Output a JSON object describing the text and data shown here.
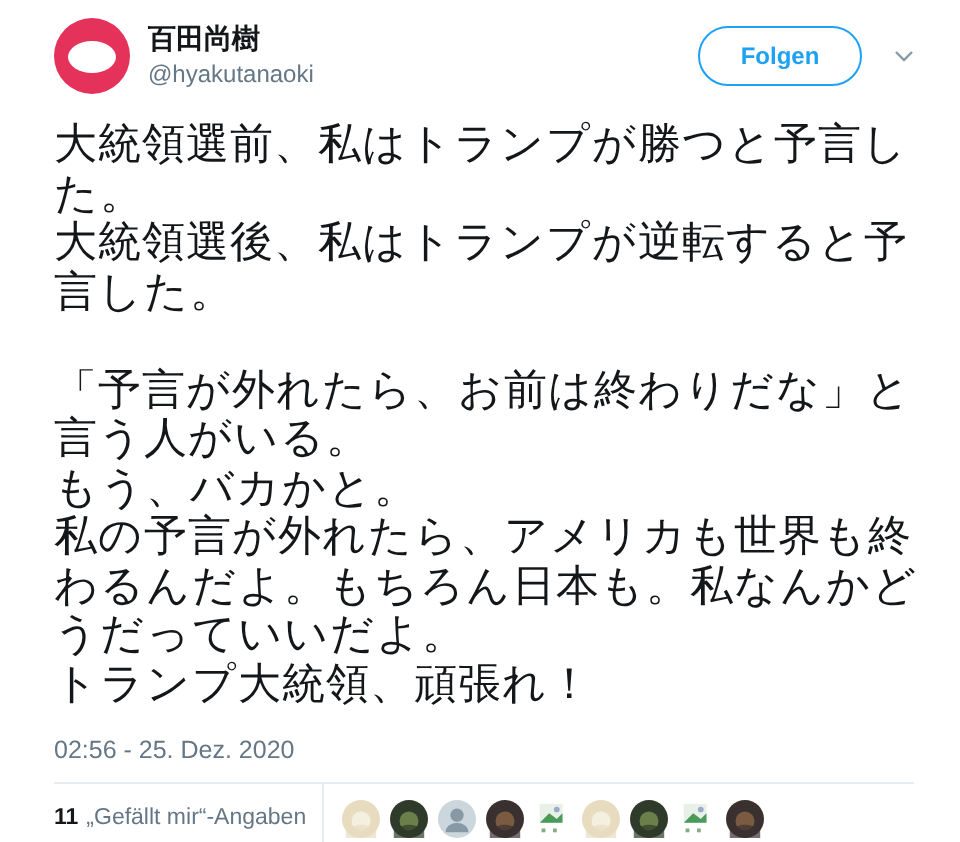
{
  "author": {
    "name": "百田尚樹",
    "handle": "@hyakutanaoki"
  },
  "follow_button": "Folgen",
  "paragraphs": [
    [
      "大統領選前、私はトランプが勝つと予言した。",
      "大統領選後、私はトランプが逆転すると予言した。"
    ],
    [
      "「予言が外れたら、お前は終わりだな」と言う人がいる。",
      "もう、バカかと。",
      "私の予言が外れたら、アメリカも世界も終わるんだよ。もちろん日本も。私なんかどうだっていいだよ。",
      "トランプ大統領、頑張れ！"
    ]
  ],
  "timestamp": "02:56 - 25. Dez. 2020",
  "likes": {
    "count": "11",
    "label": "„Gefällt mir“-Angaben",
    "avatars": [
      {
        "kind": "picture"
      },
      {
        "kind": "picture"
      },
      {
        "kind": "default"
      },
      {
        "kind": "picture"
      },
      {
        "kind": "broken"
      },
      {
        "kind": "picture"
      },
      {
        "kind": "picture"
      },
      {
        "kind": "broken"
      },
      {
        "kind": "picture"
      }
    ]
  }
}
